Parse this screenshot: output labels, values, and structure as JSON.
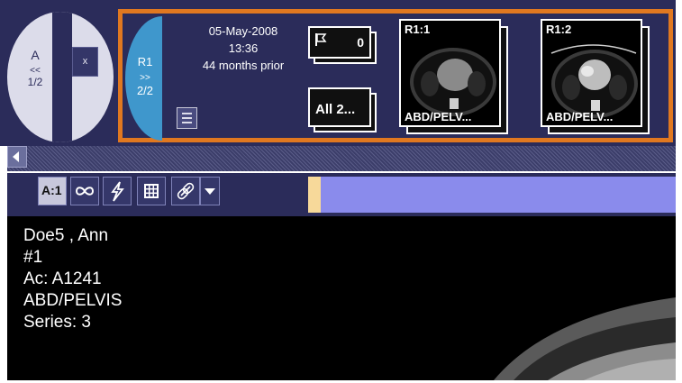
{
  "study_a": {
    "letter": "A",
    "prev_arrows": "<<",
    "count": "1/2",
    "close_label": "x"
  },
  "prior_study": {
    "tab_label": "R1",
    "next_arrows": ">>",
    "count": "2/2",
    "date": "05-May-2008",
    "time": "13:36",
    "age": "44 months prior",
    "flag_count": "0",
    "all_label": "All 2...",
    "thumbnails": [
      {
        "label": "R1:1",
        "desc": "ABD/PELV..."
      },
      {
        "label": "R1:2",
        "desc": "ABD/PELV..."
      }
    ]
  },
  "toolbar": {
    "active_viewport_label": "A:1"
  },
  "overlay": {
    "patient_name": "Doe5 ,  Ann",
    "number": "#1",
    "accession": "Ac: A1241",
    "study_desc": "ABD/PELVIS",
    "series": "Series: 3"
  },
  "colors": {
    "frame": "#2b2c5a",
    "highlight": "#e07820",
    "tab": "#3f97cc",
    "toolbar_fill": "#8a8bec"
  }
}
